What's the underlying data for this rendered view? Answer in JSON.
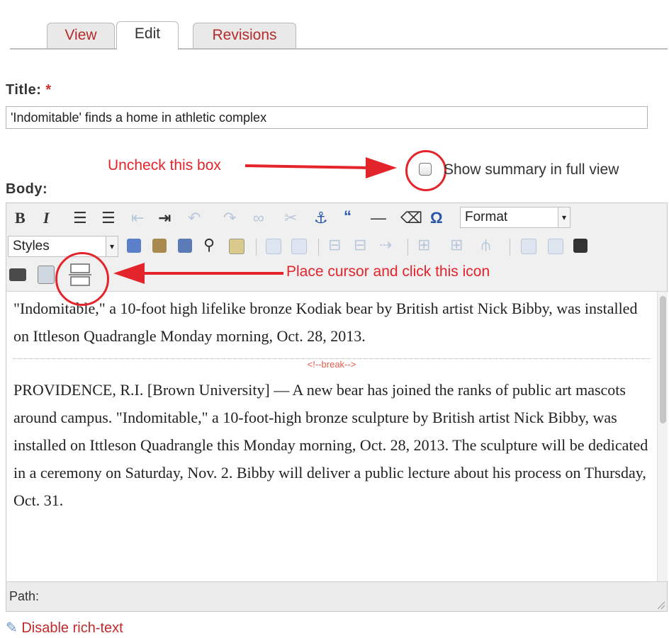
{
  "tabs": [
    {
      "label": "View",
      "active": false
    },
    {
      "label": "Edit",
      "active": true
    },
    {
      "label": "Revisions",
      "active": false
    }
  ],
  "title_field": {
    "label": "Title:",
    "required_mark": "*",
    "value": "'Indomitable' finds a home in athletic complex"
  },
  "summary": {
    "checkbox_label": "Show summary in full view",
    "checked": false
  },
  "body": {
    "label": "Body:"
  },
  "annotations": {
    "uncheck": "Uncheck this box",
    "place_cursor": "Place cursor and click this icon",
    "color": "#e3242b"
  },
  "toolbar": {
    "format_select": "Format",
    "styles_select": "Styles",
    "buttons": [
      "bold",
      "italic",
      "bulleted-list",
      "numbered-list",
      "outdent",
      "indent",
      "undo",
      "redo",
      "link",
      "unlink",
      "anchor",
      "blockquote",
      "horizontal-rule",
      "remove-format",
      "special-char",
      "format",
      "styles",
      "paste",
      "paste-text",
      "paste-word",
      "find",
      "spellcheck",
      "table",
      "table-props",
      "insert-row",
      "delete-row",
      "insert-column",
      "delete-column",
      "merge-cells",
      "split-cells",
      "media",
      "image",
      "template",
      "teaser-break"
    ]
  },
  "editor_content": {
    "paragraph_1": "\"Indomitable,\" a 10-foot high lifelike bronze Kodiak bear by British artist Nick Bibby, was installed on Ittleson Quadrangle Monday morning, Oct. 28, 2013.",
    "break_marker": "<!--break-->",
    "paragraph_2": "PROVIDENCE, R.I. [Brown University] — A new bear has joined the ranks of public art mascots around campus. \"Indomitable,\" a 10-foot-high bronze sculpture by British artist Nick Bibby, was installed on Ittleson Quadrangle this Monday morning, Oct. 28, 2013. The sculpture will be dedicated in a ceremony on Saturday, Nov. 2. Bibby will deliver a public lecture about his process on Thursday, Oct. 31."
  },
  "status_bar": {
    "path_label": "Path:"
  },
  "footer": {
    "disable_rich_text": "Disable rich-text"
  }
}
